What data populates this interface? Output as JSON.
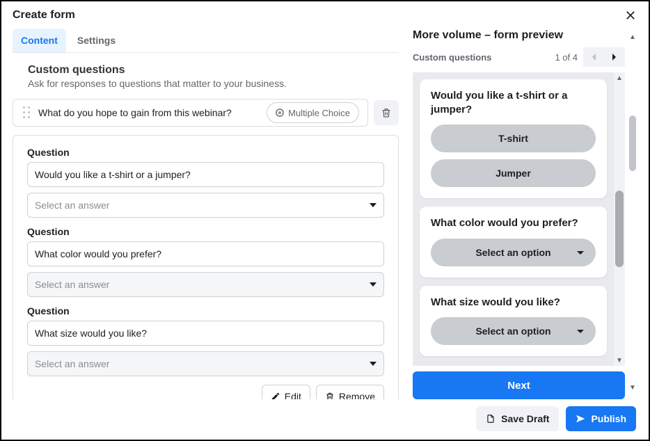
{
  "header": {
    "title": "Create form"
  },
  "tabs": {
    "content": "Content",
    "settings": "Settings"
  },
  "section": {
    "title": "Custom questions",
    "subtitle": "Ask for responses to questions that matter to your business."
  },
  "collapsed_question": {
    "text": "What do you hope to gain from this webinar?",
    "type_label": "Multiple Choice"
  },
  "editor": {
    "question_label": "Question",
    "select_placeholder": "Select an answer",
    "questions": [
      {
        "value": "Would you like a t-shirt or a jumper?",
        "select_disabled": false
      },
      {
        "value": "What color would you prefer?",
        "select_disabled": true
      },
      {
        "value": "What size would you like?",
        "select_disabled": true
      }
    ],
    "actions": {
      "edit": "Edit",
      "remove": "Remove"
    }
  },
  "preview": {
    "title": "More volume – form preview",
    "bar_label": "Custom questions",
    "page_indicator": "1 of 4",
    "cards": [
      {
        "question": "Would you like a t-shirt or a jumper?",
        "type": "buttons",
        "option1": "T-shirt",
        "option2": "Jumper"
      },
      {
        "question": "What color would you prefer?",
        "type": "select",
        "placeholder": "Select an option"
      },
      {
        "question": "What size would you like?",
        "type": "select",
        "placeholder": "Select an option"
      }
    ],
    "next_label": "Next"
  },
  "footer": {
    "save_draft": "Save Draft",
    "publish": "Publish"
  }
}
